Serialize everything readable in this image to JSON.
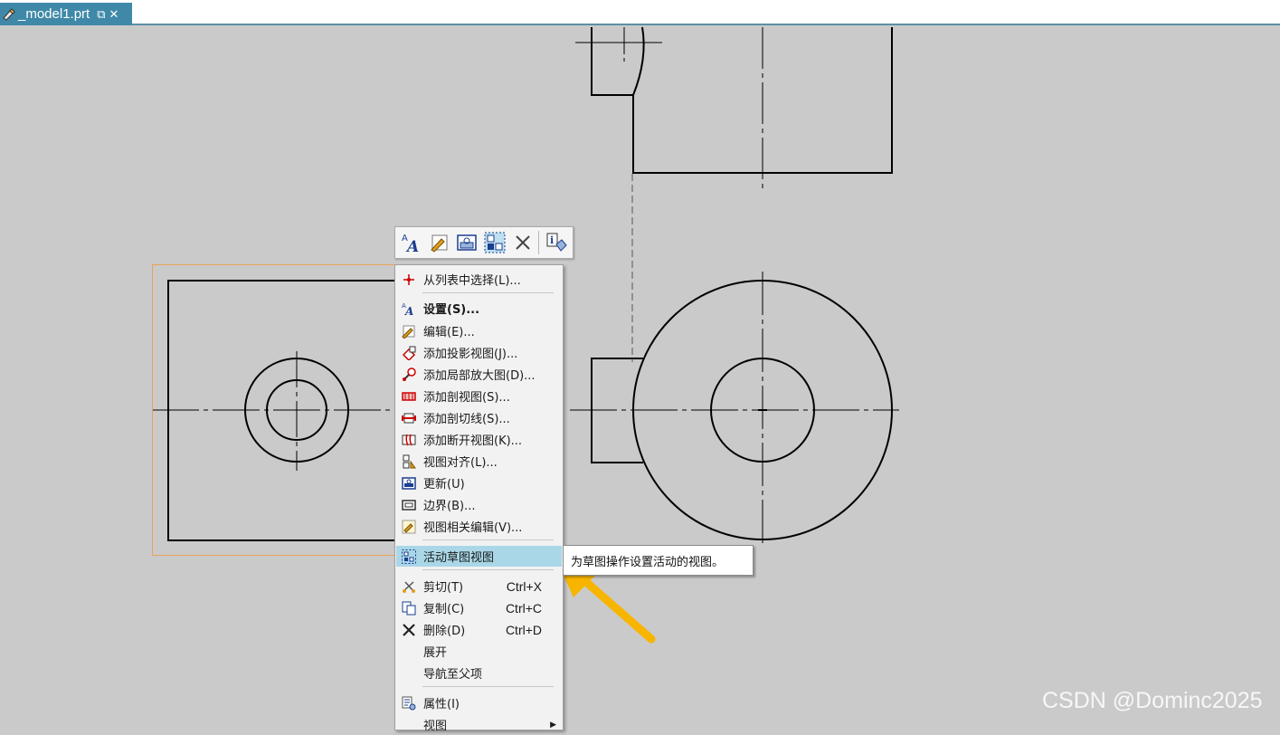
{
  "tab": {
    "title": "_model1.prt",
    "restore_glyph": "⧉",
    "close_glyph": "✕"
  },
  "mini_toolbar": {
    "buttons": [
      "settings-icon",
      "edit-icon",
      "update-view-icon",
      "active-sketch-view-icon",
      "delete-icon",
      "info-icon"
    ]
  },
  "context_menu": {
    "items": [
      {
        "label": "从列表中选择(L)...",
        "icon": "select-from-list-icon"
      },
      {
        "label": "设置(S)...",
        "icon": "settings-icon",
        "bold": true
      },
      {
        "label": "编辑(E)...",
        "icon": "edit-icon"
      },
      {
        "label": "添加投影视图(J)...",
        "icon": "projected-view-icon"
      },
      {
        "label": "添加局部放大图(D)...",
        "icon": "detail-view-icon"
      },
      {
        "label": "添加剖视图(S)...",
        "icon": "section-view-icon"
      },
      {
        "label": "添加剖切线(S)...",
        "icon": "section-line-icon"
      },
      {
        "label": "添加断开视图(K)...",
        "icon": "broken-view-icon"
      },
      {
        "label": "视图对齐(L)...",
        "icon": "view-align-icon"
      },
      {
        "label": "更新(U)",
        "icon": "update-icon"
      },
      {
        "label": "边界(B)...",
        "icon": "boundary-icon"
      },
      {
        "label": "视图相关编辑(V)...",
        "icon": "view-dependent-edit-icon"
      },
      {
        "label": "活动草图视图",
        "icon": "active-sketch-view-icon",
        "highlighted": true
      },
      {
        "label": "剪切(T)",
        "icon": "cut-icon",
        "shortcut": "Ctrl+X"
      },
      {
        "label": "复制(C)",
        "icon": "copy-icon",
        "shortcut": "Ctrl+C"
      },
      {
        "label": "删除(D)",
        "icon": "delete-icon",
        "shortcut": "Ctrl+D"
      },
      {
        "label": "展开",
        "icon": ""
      },
      {
        "label": "导航至父项",
        "icon": ""
      },
      {
        "label": "属性(I)",
        "icon": "properties-icon"
      },
      {
        "label": "视图",
        "icon": "",
        "submenu": true
      }
    ]
  },
  "tooltip": {
    "text": "为草图操作设置活动的视图。"
  },
  "watermark": "CSDN @Dominc2025",
  "colors": {
    "canvas": "#cacaca",
    "tab_active": "#3f88a8",
    "selection_border": "#e8a35a",
    "highlight": "#a9d7e7",
    "arrow": "#f7b500"
  }
}
